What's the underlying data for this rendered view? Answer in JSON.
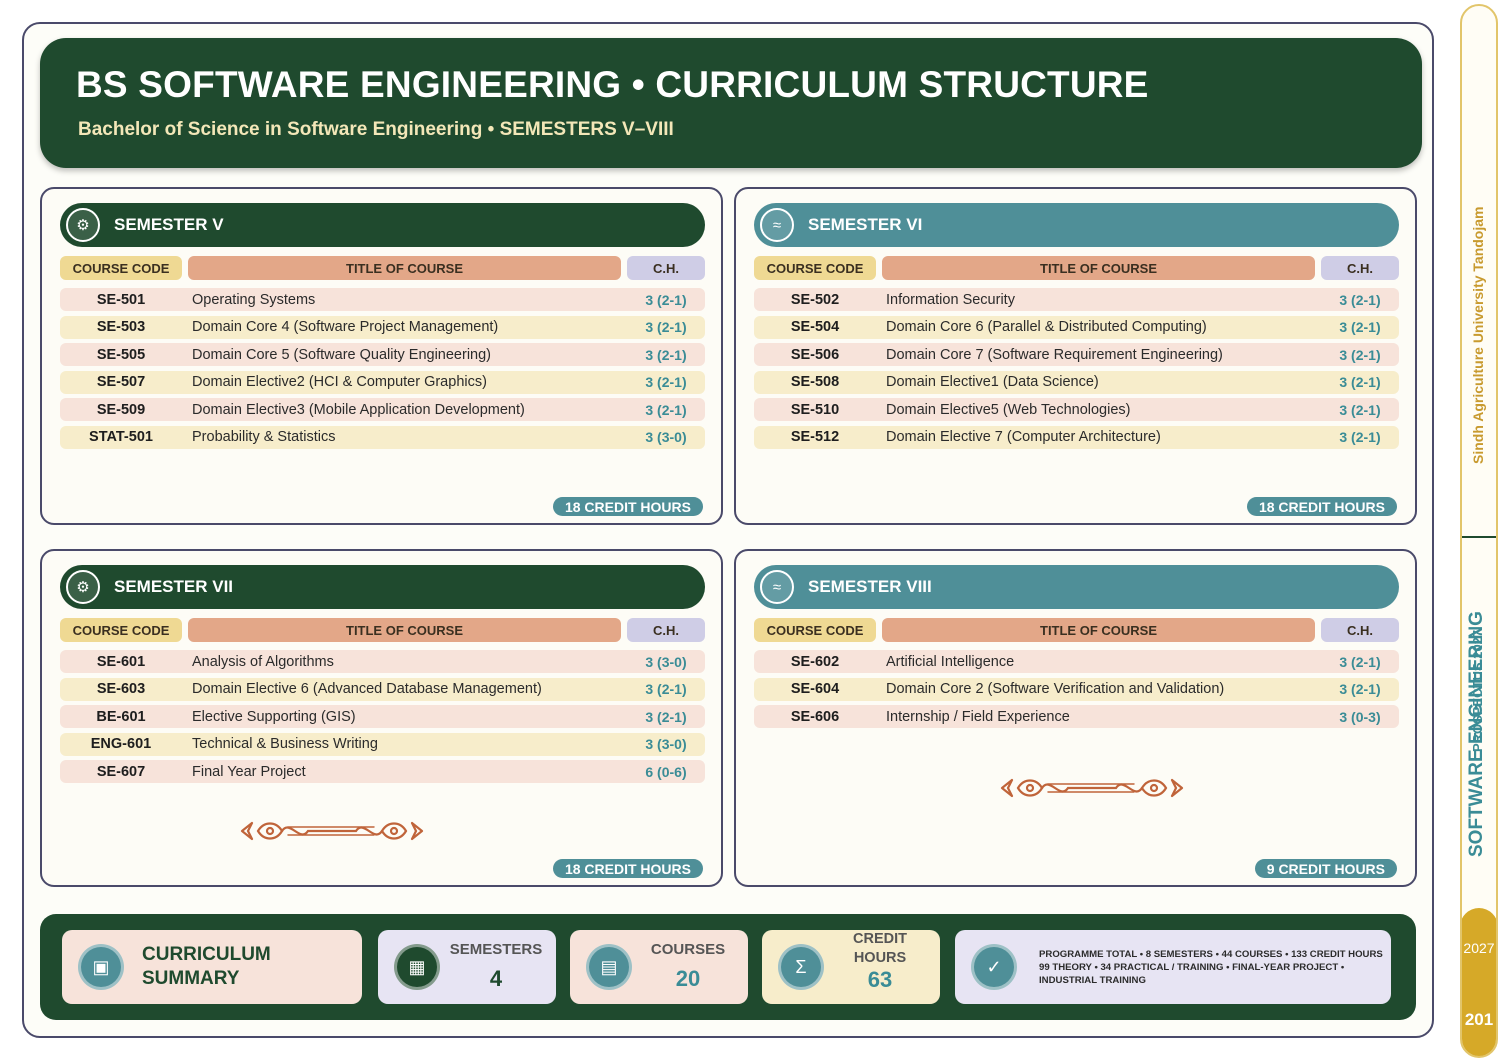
{
  "header": {
    "title": "BS SOFTWARE ENGINEERING • CURRICULUM STRUCTURE",
    "subtitle": "Bachelor of Science in Software Engineering • SEMESTERS V–VIII"
  },
  "columns": {
    "code": "COURSE CODE",
    "title": "TITLE OF COURSE",
    "ch": "C.H."
  },
  "semesters": [
    {
      "name": "SEMESTER V",
      "icon": "gear-icon",
      "courses": [
        {
          "code": "SE-501",
          "title": "Operating Systems",
          "ch": "3 (2-1)"
        },
        {
          "code": "SE-503",
          "title": "Domain Core 4 (Software Project Management)",
          "ch": "3 (2-1)"
        },
        {
          "code": "SE-505",
          "title": "Domain Core 5 (Software Quality Engineering)",
          "ch": "3 (2-1)"
        },
        {
          "code": "SE-507",
          "title": "Domain Elective2 (HCI & Computer Graphics)",
          "ch": "3 (2-1)"
        },
        {
          "code": "SE-509",
          "title": "Domain Elective3 (Mobile Application Development)",
          "ch": "3 (2-1)"
        },
        {
          "code": "STAT-501",
          "title": "Probability & Statistics",
          "ch": "3 (3-0)"
        }
      ],
      "credits": "18 CREDIT HOURS"
    },
    {
      "name": "SEMESTER VI",
      "icon": "wave-icon",
      "courses": [
        {
          "code": "SE-502",
          "title": "Information Security",
          "ch": "3 (2-1)"
        },
        {
          "code": "SE-504",
          "title": "Domain Core 6 (Parallel & Distributed Computing)",
          "ch": "3 (2-1)"
        },
        {
          "code": "SE-506",
          "title": "Domain Core 7 (Software Requirement Engineering)",
          "ch": "3 (2-1)"
        },
        {
          "code": "SE-508",
          "title": "Domain Elective1 (Data Science)",
          "ch": "3 (2-1)"
        },
        {
          "code": "SE-510",
          "title": "Domain Elective5 (Web Technologies)",
          "ch": "3 (2-1)"
        },
        {
          "code": "SE-512",
          "title": "Domain Elective 7 (Computer Architecture)",
          "ch": "3 (2-1)"
        }
      ],
      "credits": "18 CREDIT HOURS"
    },
    {
      "name": "SEMESTER VII",
      "icon": "gear-icon",
      "courses": [
        {
          "code": "SE-601",
          "title": "Analysis of Algorithms",
          "ch": "3 (3-0)"
        },
        {
          "code": "SE-603",
          "title": "Domain Elective 6 (Advanced Database Management)",
          "ch": "3 (2-1)"
        },
        {
          "code": "BE-601",
          "title": "Elective Supporting (GIS)",
          "ch": "3 (2-1)"
        },
        {
          "code": "ENG-601",
          "title": "Technical & Business Writing",
          "ch": "3 (3-0)"
        },
        {
          "code": "SE-607",
          "title": "Final Year Project",
          "ch": "6 (0-6)"
        }
      ],
      "credits": "18 CREDIT HOURS"
    },
    {
      "name": "SEMESTER VIII",
      "icon": "wave-icon",
      "courses": [
        {
          "code": "SE-602",
          "title": "Artificial Intelligence",
          "ch": "3 (2-1)"
        },
        {
          "code": "SE-604",
          "title": "Domain Core 2 (Software Verification and Validation)",
          "ch": "3 (2-1)"
        },
        {
          "code": "SE-606",
          "title": "Internship / Field Experience",
          "ch": "3 (0-3)"
        }
      ],
      "credits": "9 CREDIT HOURS"
    }
  ],
  "summary": {
    "label": "CURRICULUM SUMMARY",
    "semesters_label": "SEMESTERS",
    "semesters_value": "4",
    "courses_label": "COURSES",
    "courses_value": "20",
    "credit_label": "CREDIT HOURS",
    "credit_value": "63",
    "programme_line1": "PROGRAMME TOTAL • 8 SEMESTERS • 44 COURSES • 133 CREDIT HOURS",
    "programme_line2": "99 THEORY • 34 PRACTICAL / TRAINING • FINAL-YEAR PROJECT •",
    "programme_line3": "INDUSTRIAL TRAINING"
  },
  "sidebar": {
    "university": "Sindh Agriculture University Tandojam",
    "prospectus": "PROSPECTUS 2027",
    "programme": "SOFTWARE ENGINEERING",
    "year": "2027",
    "page": "201"
  },
  "colors": {
    "dark_green": "#1f4a2e",
    "teal": "#4f8f98",
    "gold": "#d6a928",
    "ornament": "#c0643a"
  }
}
